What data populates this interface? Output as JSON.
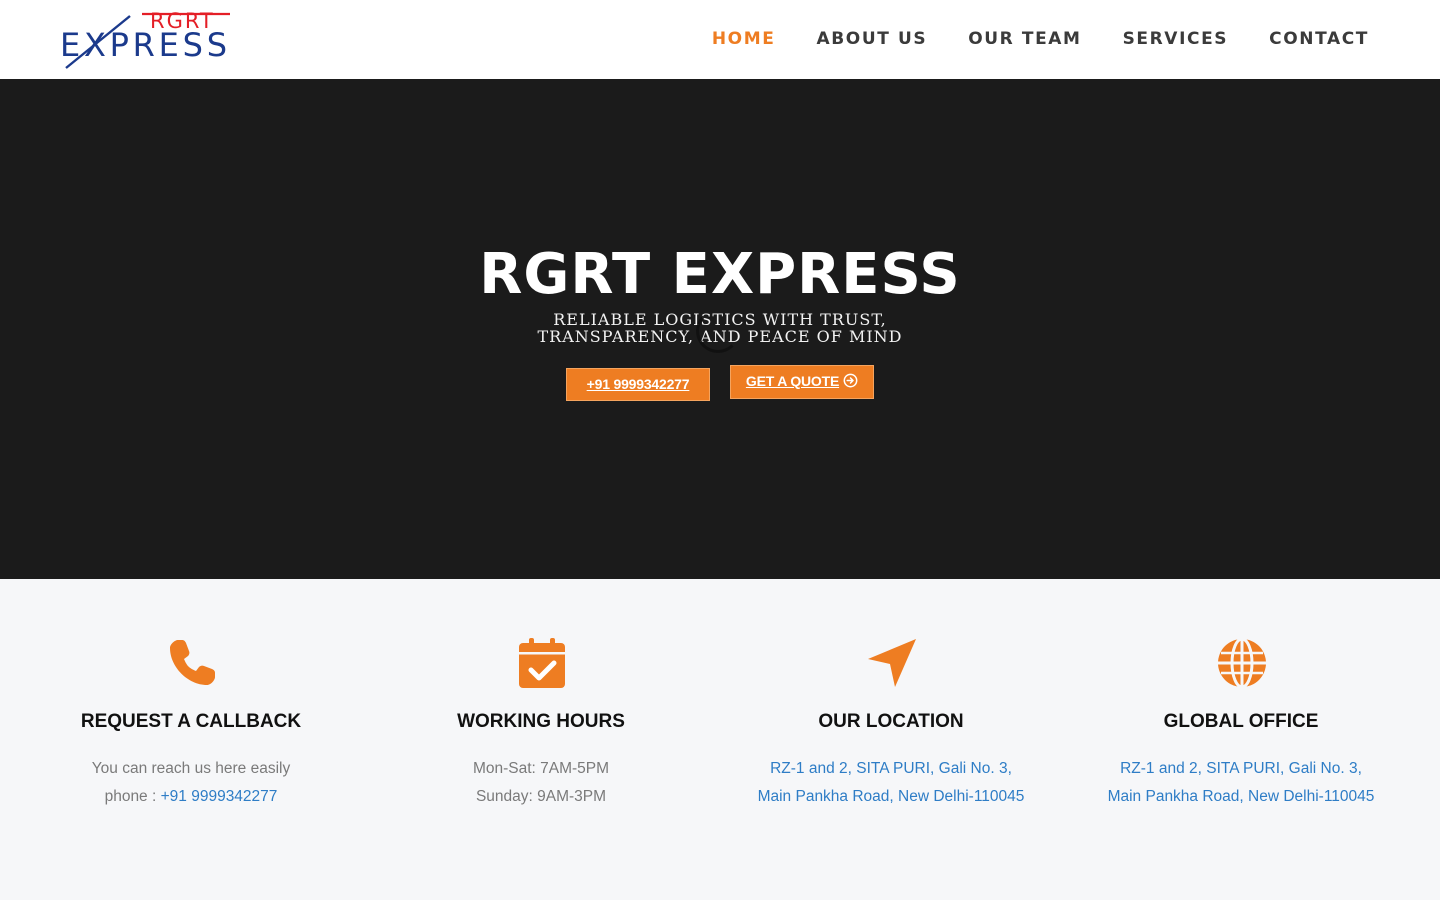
{
  "brand": {
    "logo_top": "RGRT",
    "logo_bottom": "EXPRESS",
    "colors": {
      "red": "#e41e26",
      "navy": "#1b3a8c",
      "accent": "#ee7d22"
    }
  },
  "nav": [
    {
      "label": "HOME",
      "active": true
    },
    {
      "label": "ABOUT US"
    },
    {
      "label": "OUR TEAM"
    },
    {
      "label": "SERVICES"
    },
    {
      "label": "CONTACT"
    }
  ],
  "hero": {
    "title": "RGRT EXPRESS",
    "subtitle_line1": "RELIABLE LOGISTICS WITH TRUST,",
    "subtitle_line2": "TRANSPARENCY, AND PEACE OF MIND",
    "phone_button": "+91 9999342277",
    "quote_button": "GET A QUOTE"
  },
  "features": [
    {
      "icon": "phone-icon",
      "title": "REQUEST A CALLBACK",
      "line1": "You can reach us here easily",
      "line2_prefix": "phone : ",
      "line2_link": "+91 9999342277"
    },
    {
      "icon": "calendar-check-icon",
      "title": "WORKING HOURS",
      "line1": "Mon-Sat: 7AM-5PM",
      "line2": "Sunday: 9AM-3PM"
    },
    {
      "icon": "location-arrow-icon",
      "title": "OUR LOCATION",
      "line1": "RZ-1 and 2, SITA PURI, Gali No. 3,",
      "line2": "Main Pankha Road, New Delhi-110045"
    },
    {
      "icon": "globe-icon",
      "title": "GLOBAL OFFICE",
      "line1": "RZ-1 and 2, SITA PURI, Gali No. 3,",
      "line2": "Main Pankha Road, New Delhi-110045"
    }
  ]
}
